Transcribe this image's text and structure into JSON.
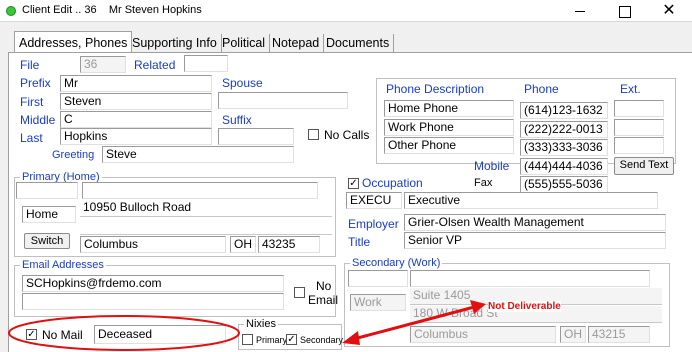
{
  "window": {
    "title": "Client Edit .. 36    Mr Steven Hopkins",
    "minimize_icon": "minimize-icon",
    "maximize_icon": "maximize-icon",
    "close_glyph": "✕"
  },
  "tabs": [
    {
      "label": "Addresses, Phones",
      "active": true
    },
    {
      "label": "Supporting Info",
      "active": false
    },
    {
      "label": "Political",
      "active": false
    },
    {
      "label": "Notepad",
      "active": false
    },
    {
      "label": "Documents",
      "active": false
    }
  ],
  "client": {
    "file_label": "File",
    "file_value": "36",
    "related_label": "Related",
    "related_value": "",
    "prefix_label": "Prefix",
    "prefix_value": "Mr",
    "spouse_label": "Spouse",
    "spouse_value": "",
    "first_label": "First",
    "first_value": "Steven",
    "middle_label": "Middle",
    "middle_value": "C",
    "suffix_label": "Suffix",
    "suffix_value": "",
    "last_label": "Last",
    "last_value": "Hopkins",
    "no_calls_label": "No Calls",
    "no_calls_checked": false,
    "greeting_label": "Greeting",
    "greeting_value": "Steve"
  },
  "phones": {
    "header_desc": "Phone Description",
    "header_phone": "Phone",
    "header_ext": "Ext.",
    "rows": [
      {
        "desc": "Home Phone",
        "phone": "(614)123-1632",
        "ext": ""
      },
      {
        "desc": "Work Phone",
        "phone": "(222)222-0013",
        "ext": ""
      },
      {
        "desc": "Other Phone",
        "phone": "(333)333-3036",
        "ext": ""
      }
    ],
    "mobile_label": "Mobile",
    "mobile_value": "(444)444-4036",
    "send_text_label": "Send Text",
    "fax_label": "Fax",
    "fax_value": "(555)555-5036"
  },
  "primary_address": {
    "legend": "Primary (Home)",
    "type_label": "Home",
    "line1": "10950 Bulloch Road",
    "line2": "",
    "switch_label": "Switch",
    "city": "Columbus",
    "state": "OH",
    "zip": "43235"
  },
  "occupation": {
    "label": "Occupation",
    "checked": true,
    "code": "EXECU",
    "value": "Executive",
    "employer_label": "Employer",
    "employer_value": "Grier-Olsen Wealth Management",
    "title_label": "Title",
    "title_value": "Senior VP"
  },
  "email": {
    "legend": "Email Addresses",
    "address1": "SCHopkins@frdemo.com",
    "address2": "",
    "no_email_line1": "No",
    "no_email_line2": "Email",
    "no_email_checked": false
  },
  "secondary_address": {
    "legend": "Secondary (Work)",
    "type_label": "Work",
    "line1": "Suite 1405",
    "line2": "180 W Broad St",
    "city": "Columbus",
    "state": "OH",
    "zip": "43215",
    "not_deliverable": "Not Deliverable"
  },
  "mail": {
    "no_mail_label": "No Mail",
    "no_mail_checked": true,
    "status_value": "Deceased"
  },
  "nixies": {
    "legend": "Nixies",
    "primary_label": "Primary",
    "primary_checked": false,
    "secondary_label": "Secondary",
    "secondary_checked": true
  },
  "annotation": {
    "color": "#e01010"
  }
}
